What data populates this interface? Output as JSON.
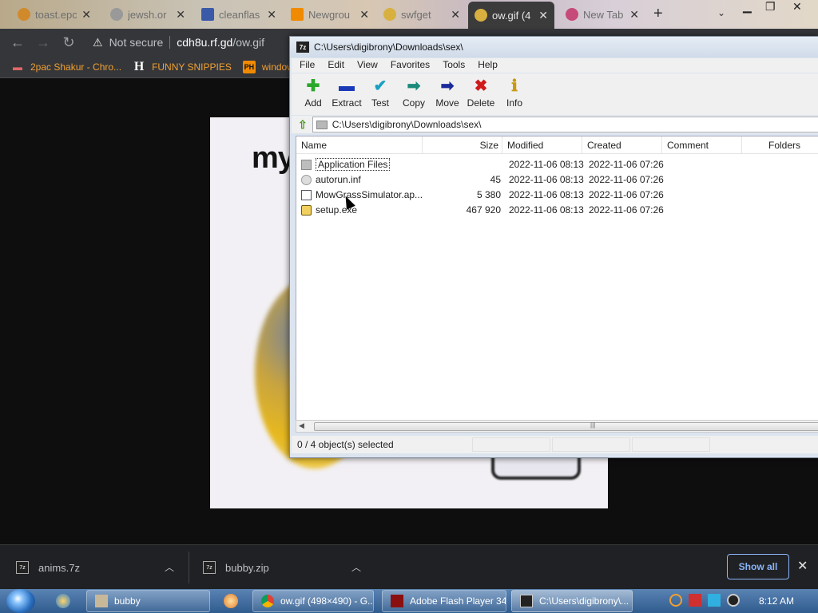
{
  "browser": {
    "tabs": [
      {
        "title": "toast.epc",
        "favicon_color": "#d08a2c"
      },
      {
        "title": "jewsh.or",
        "favicon_color": "#999999"
      },
      {
        "title": "cleanflas",
        "favicon_color": "#3a5aa8"
      },
      {
        "title": "Newgrou",
        "favicon_color": "#f08a00"
      },
      {
        "title": "swfget",
        "favicon_color": "#d8b040"
      },
      {
        "title": "ow.gif (4",
        "favicon_color": "#d8b040",
        "active": true
      },
      {
        "title": "New Tab",
        "favicon_color": "#c64a7a"
      }
    ],
    "new_tab_symbol": "+",
    "address": {
      "security_label": "Not secure",
      "host": "cdh8u.rf.gd",
      "path": "/ow.gif"
    },
    "bookmarks": [
      {
        "label": "2pac Shakur - Chro...",
        "icon": "cake-icon"
      },
      {
        "label": "FUNNY SNIPPIES",
        "icon": "H"
      },
      {
        "label": "windows",
        "icon": "PH"
      }
    ]
  },
  "page": {
    "image_text": "my"
  },
  "sevenzip": {
    "title": "C:\\Users\\digibrony\\Downloads\\sex\\",
    "logo": "7z",
    "menu": [
      "File",
      "Edit",
      "View",
      "Favorites",
      "Tools",
      "Help"
    ],
    "toolbar": [
      {
        "label": "Add",
        "icon": "add-icon",
        "glyph": "✚",
        "color": "#2aa82a"
      },
      {
        "label": "Extract",
        "icon": "extract-icon",
        "glyph": "▬",
        "color": "#1a3ab8"
      },
      {
        "label": "Test",
        "icon": "test-icon",
        "glyph": "✔",
        "color": "#1aa0c0"
      },
      {
        "label": "Copy",
        "icon": "copy-icon",
        "glyph": "➡",
        "color": "#1a8a7a"
      },
      {
        "label": "Move",
        "icon": "move-icon",
        "glyph": "➡",
        "color": "#1a2a9a"
      },
      {
        "label": "Delete",
        "icon": "delete-icon",
        "glyph": "✖",
        "color": "#d01a1a"
      },
      {
        "label": "Info",
        "icon": "info-icon",
        "glyph": "ℹ",
        "color": "#c89a10"
      }
    ],
    "path": "C:\\Users\\digibrony\\Downloads\\sex\\",
    "columns": [
      "Name",
      "Size",
      "Modified",
      "Created",
      "Comment",
      "Folders"
    ],
    "files": [
      {
        "name": "Application Files",
        "size": "",
        "modified": "2022-11-06 08:13",
        "created": "2022-11-06 07:26",
        "type": "folder"
      },
      {
        "name": "autorun.inf",
        "size": "45",
        "modified": "2022-11-06 08:13",
        "created": "2022-11-06 07:26",
        "type": "inf"
      },
      {
        "name": "MowGrassSimulator.ap...",
        "size": "5 380",
        "modified": "2022-11-06 08:13",
        "created": "2022-11-06 07:26",
        "type": "app"
      },
      {
        "name": "setup.exe",
        "size": "467 920",
        "modified": "2022-11-06 08:13",
        "created": "2022-11-06 07:26",
        "type": "exe"
      }
    ],
    "status": "0 / 4 object(s) selected"
  },
  "downloads": {
    "items": [
      {
        "name": "anims.7z"
      },
      {
        "name": "bubby.zip"
      }
    ],
    "show_all": "Show all"
  },
  "taskbar": {
    "tasks": [
      {
        "label": "bubby",
        "icon": "folder-icon"
      },
      {
        "label": "ow.gif (498×490) - G...",
        "icon": "chrome-icon"
      },
      {
        "label": "Adobe Flash Player 34",
        "icon": "flash-icon"
      },
      {
        "label": "C:\\Users\\digibrony\\...",
        "icon": "sevenzip-icon"
      }
    ],
    "clock": "8:12 AM"
  }
}
